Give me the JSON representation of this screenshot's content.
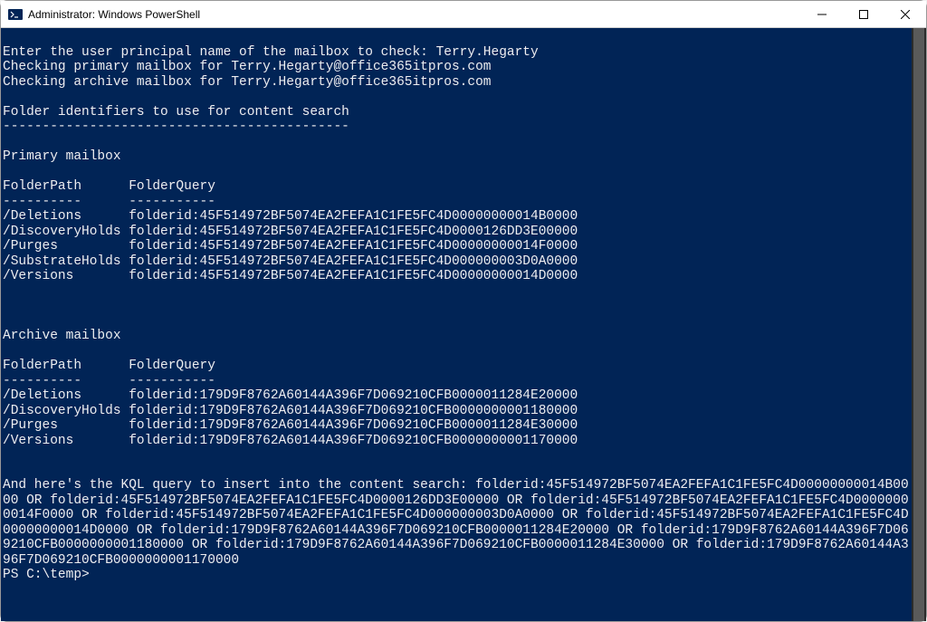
{
  "window": {
    "title": "Administrator: Windows PowerShell"
  },
  "terminal": {
    "promptLine": "Enter the user principal name of the mailbox to check: Terry.Hegarty",
    "line2": "Checking primary mailbox for Terry.Hegarty@office365itpros.com",
    "line3": "Checking archive mailbox for Terry.Hegarty@office365itpros.com",
    "headerTitle": "Folder identifiers to use for content search",
    "headerSep": "--------------------------------------------",
    "primarySection": {
      "title": "Primary mailbox",
      "header": "FolderPath      FolderQuery",
      "headerSep": "----------      -----------",
      "rows": [
        "/Deletions      folderid:45F514972BF5074EA2FEFA1C1FE5FC4D00000000014B0000",
        "/DiscoveryHolds folderid:45F514972BF5074EA2FEFA1C1FE5FC4D0000126DD3E00000",
        "/Purges         folderid:45F514972BF5074EA2FEFA1C1FE5FC4D00000000014F0000",
        "/SubstrateHolds folderid:45F514972BF5074EA2FEFA1C1FE5FC4D000000003D0A0000",
        "/Versions       folderid:45F514972BF5074EA2FEFA1C1FE5FC4D00000000014D0000"
      ]
    },
    "archiveSection": {
      "title": "Archive mailbox",
      "header": "FolderPath      FolderQuery",
      "headerSep": "----------      -----------",
      "rows": [
        "/Deletions      folderid:179D9F8762A60144A396F7D069210CFB0000011284E20000",
        "/DiscoveryHolds folderid:179D9F8762A60144A396F7D069210CFB0000000001180000",
        "/Purges         folderid:179D9F8762A60144A396F7D069210CFB0000011284E30000",
        "/Versions       folderid:179D9F8762A60144A396F7D069210CFB0000000001170000"
      ]
    },
    "kqlText": "And here's the KQL query to insert into the content search: folderid:45F514972BF5074EA2FEFA1C1FE5FC4D00000000014B0000 OR folderid:45F514972BF5074EA2FEFA1C1FE5FC4D0000126DD3E00000 OR folderid:45F514972BF5074EA2FEFA1C1FE5FC4D00000000014F0000 OR folderid:45F514972BF5074EA2FEFA1C1FE5FC4D000000003D0A0000 OR folderid:45F514972BF5074EA2FEFA1C1FE5FC4D00000000014D0000 OR folderid:179D9F8762A60144A396F7D069210CFB0000011284E20000 OR folderid:179D9F8762A60144A396F7D069210CFB0000000001180000 OR folderid:179D9F8762A60144A396F7D069210CFB0000011284E30000 OR folderid:179D9F8762A60144A396F7D069210CFB0000000001170000",
    "psPrompt": "PS C:\\temp>"
  }
}
